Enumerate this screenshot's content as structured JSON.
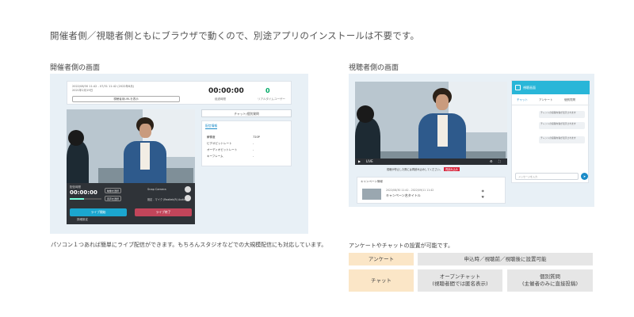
{
  "headline": "開催者側／視聴者側ともにブラウザで動くので、別途アプリのインストールは不要です。",
  "left": {
    "title": "開催者側の画面",
    "description": "パソコン１つあれば簡単にライブ配信ができます。もちろんスタジオなどでの大規模配信にも対応しています。",
    "top": {
      "date": "2022/08/30 11:42 - 07/31 11:42 (2022年8月)",
      "subtitle": "2021年2月19日",
      "link_button": "視聴者用URLを表示",
      "time": "00:00:00",
      "time_label": "経過時間",
      "viewers": "0",
      "viewers_label": "リアルタイムユーザー"
    },
    "controls": {
      "label": "配信時間",
      "clock": "00:00:00",
      "progress": 0.45,
      "camera_btn": "映像を選択",
      "mic_btn": "音声を選択",
      "camera_name": "Snap Camera",
      "mic_name": "既定 - マイク (Realtek(R) Audio)",
      "start": "ライブ開始",
      "stop": "ライブ終了",
      "settings": "詳細設定"
    },
    "side_button": "チャット/個別質問",
    "info": {
      "tab": "配信情報",
      "rows": [
        {
          "label": "解像度",
          "value": "720P"
        },
        {
          "label": "ビデオビットレート",
          "value": "-"
        },
        {
          "label": "オーディオビットレート",
          "value": "-"
        },
        {
          "label": "キーフレーム",
          "value": "-"
        }
      ]
    }
  },
  "right": {
    "title": "視聴者側の画面",
    "description": "アンケートやチャットの設置が可能です。",
    "bar": {
      "play": "▶",
      "live": "LIVE"
    },
    "note": "視聴が停止した際には再読み込みしてください。",
    "note_badge": "再読み込み",
    "card": {
      "header": "キャンペーン情報",
      "date": "2022/08/30 11:42 - 2022/09/11 11:42",
      "title": "キャンペーン名タイトル"
    },
    "chat": {
      "header": "視聴画面",
      "tabs": [
        "チャット",
        "アンケート",
        "個別質問"
      ],
      "messages": [
        "チャットの投稿内容が表示されます",
        "チャットの投稿内容が表示されます",
        "チャットの投稿内容が表示されます"
      ],
      "placeholder": "メッセージを入力",
      "send": "➤"
    }
  },
  "features": {
    "rows": [
      {
        "name": "アンケート",
        "cells": [
          "申込時／視聴前／視聴後に設置可能"
        ]
      },
      {
        "name": "チャット",
        "cells": [
          "オープンチャット\n(視聴者間では匿名表示)",
          "個別質問\n(主催者のみに直接投稿)"
        ]
      }
    ]
  },
  "colors": {
    "panel": "#e8f0f6",
    "accent": "#1ba6cf",
    "danger": "#c2455a",
    "feature_label": "#fbe6c7",
    "feature_value": "#e6e6e6"
  }
}
